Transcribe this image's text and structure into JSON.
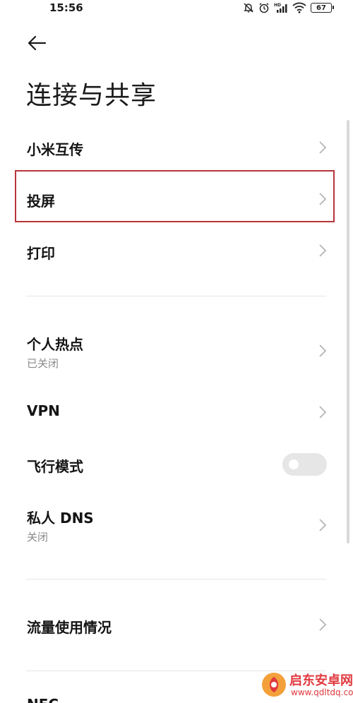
{
  "status_bar": {
    "time": "15:56",
    "battery": "67",
    "icons": [
      "mute-bell-icon",
      "alarm-icon",
      "hd-signal-icon",
      "wifi-icon",
      "battery-icon"
    ]
  },
  "header": {
    "back_icon": "back-arrow-icon",
    "title": "连接与共享"
  },
  "items": [
    {
      "label": "小米互传",
      "sub": ""
    },
    {
      "label": "投屏",
      "sub": "",
      "highlighted": true
    },
    {
      "label": "打印",
      "sub": ""
    },
    {
      "label": "个人热点",
      "sub": "已关闭"
    },
    {
      "label": "VPN",
      "sub": ""
    },
    {
      "label": "飞行模式",
      "sub": "",
      "toggle": false
    },
    {
      "label": "私人 DNS",
      "sub": "关闭"
    },
    {
      "label": "流量使用情况",
      "sub": ""
    },
    {
      "label": "NFC",
      "sub": ""
    }
  ],
  "watermark": {
    "title": "启东安卓网",
    "url": "www.qdltdq.com"
  },
  "colors": {
    "highlight_border": "#b8343a",
    "toggle_off": "#e6e6e6",
    "subtext": "#8a8a8a",
    "watermark": "#e0393e"
  }
}
